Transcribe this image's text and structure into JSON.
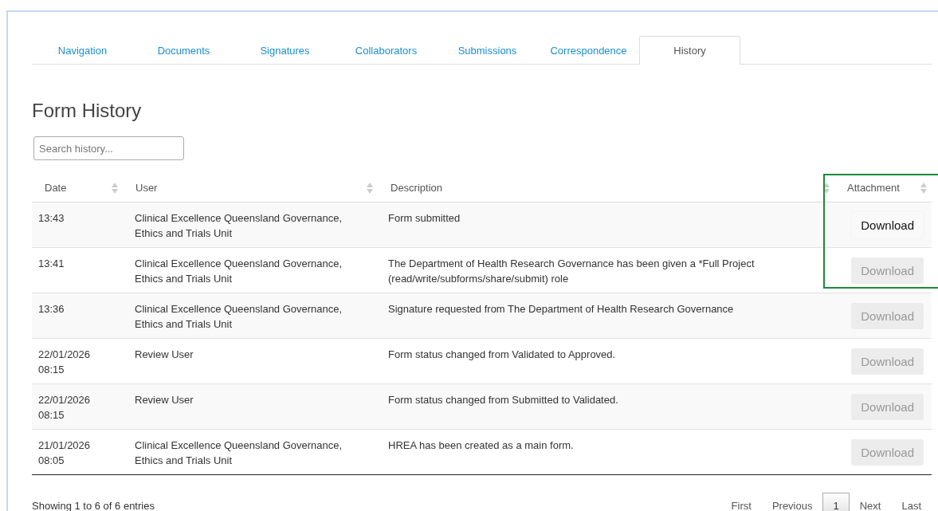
{
  "tabs": [
    {
      "label": "Navigation",
      "selected": false
    },
    {
      "label": "Documents",
      "selected": false
    },
    {
      "label": "Signatures",
      "selected": false
    },
    {
      "label": "Collaborators",
      "selected": false
    },
    {
      "label": "Submissions",
      "selected": false
    },
    {
      "label": "Correspondence",
      "selected": false
    },
    {
      "label": "History",
      "selected": true
    }
  ],
  "title": "Form History",
  "search": {
    "placeholder": "Search history..."
  },
  "table": {
    "columns": [
      "Date",
      "User",
      "Description",
      "Attachment"
    ],
    "rows": [
      {
        "date": "13:43",
        "user": "Clinical Excellence Queensland Governance, Ethics and Trials Unit",
        "description": "Form submitted",
        "button": {
          "label": "Download",
          "disabled": false
        }
      },
      {
        "date": "13:41",
        "user": "Clinical Excellence Queensland Governance, Ethics and Trials Unit",
        "description": "The Department of Health Research Governance has been given a *Full Project (read/write/subforms/share/submit) role",
        "button": {
          "label": "Download",
          "disabled": true
        }
      },
      {
        "date": "13:36",
        "user": "Clinical Excellence Queensland Governance, Ethics and Trials Unit",
        "description": "Signature requested from The Department of Health Research Governance",
        "button": {
          "label": "Download",
          "disabled": true
        }
      },
      {
        "date": "22/01/2026 08:15",
        "user": "Review User",
        "description": "Form status changed from Validated to Approved.",
        "button": {
          "label": "Download",
          "disabled": true
        }
      },
      {
        "date": "22/01/2026 08:15",
        "user": "Review User",
        "description": "Form status changed from Submitted to Validated.",
        "button": {
          "label": "Download",
          "disabled": true
        }
      },
      {
        "date": "21/01/2026 08:05",
        "user": "Clinical Excellence Queensland Governance, Ethics and Trials Unit",
        "description": "HREA has been created as a main form.",
        "button": {
          "label": "Download",
          "disabled": true
        }
      }
    ]
  },
  "footer": {
    "info": "Showing 1 to 6 of 6 entries",
    "pagination": [
      {
        "label": "First",
        "selected": false
      },
      {
        "label": "Previous",
        "selected": false
      },
      {
        "label": "1",
        "selected": true
      },
      {
        "label": "Next",
        "selected": false
      },
      {
        "label": "Last",
        "selected": false
      }
    ]
  }
}
